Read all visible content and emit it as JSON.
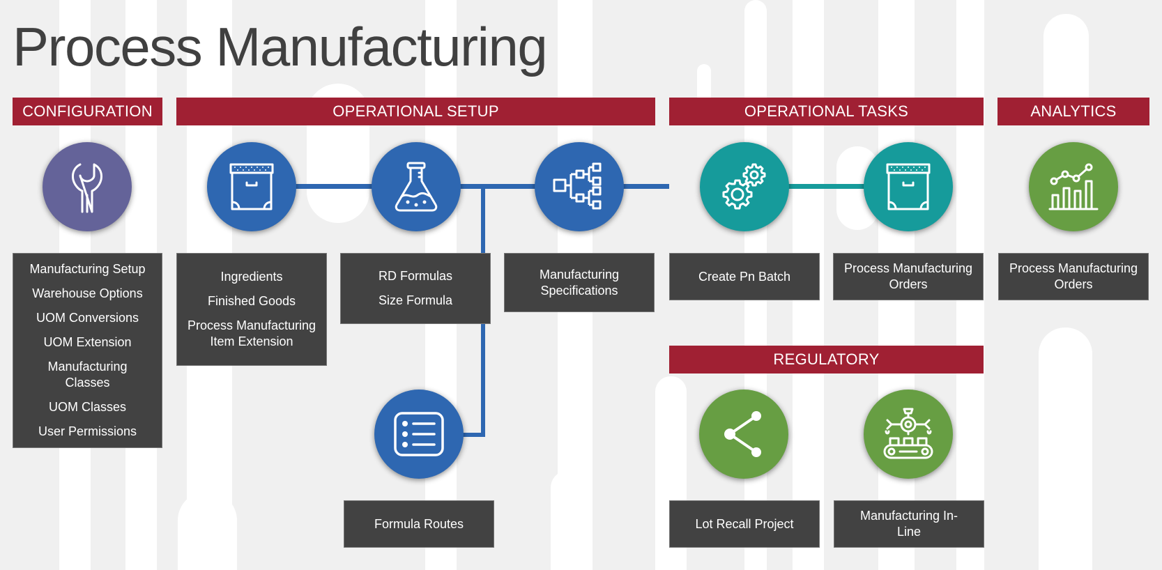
{
  "title": "Process Manufacturing",
  "colors": {
    "header": "#a02033",
    "configuration": "#646399",
    "operational_setup": "#2e67b1",
    "operational_tasks": "#169b9b",
    "analytics": "#679e43",
    "regulatory": "#679e43",
    "box": "#424242",
    "background": "#f0f0f0"
  },
  "sections": {
    "configuration": {
      "header": "CONFIGURATION",
      "icon": "wrench-icon",
      "items": [
        "Manufacturing Setup",
        "Warehouse Options",
        "UOM Conversions",
        "UOM Extension",
        "Manufacturing Classes",
        "UOM Classes",
        "User Permissions"
      ]
    },
    "operational_setup": {
      "header": "OPERATIONAL SETUP",
      "nodes": [
        {
          "icon": "storage-box-icon",
          "items": [
            "Ingredients",
            "Finished Goods",
            "Process Manufacturing Item Extension"
          ]
        },
        {
          "icon": "flask-icon",
          "items": [
            "RD Formulas",
            "Size Formula"
          ]
        },
        {
          "icon": "hierarchy-icon",
          "items": [
            "Manufacturing Specifications"
          ]
        },
        {
          "icon": "list-icon",
          "items": [
            "Formula Routes"
          ]
        }
      ]
    },
    "operational_tasks": {
      "header": "OPERATIONAL TASKS",
      "nodes": [
        {
          "icon": "gears-icon",
          "items": [
            "Create Pn Batch"
          ]
        },
        {
          "icon": "storage-box-icon",
          "items": [
            "Process Manufacturing Orders"
          ]
        }
      ]
    },
    "analytics": {
      "header": "ANALYTICS",
      "nodes": [
        {
          "icon": "chart-icon",
          "items": [
            "Process Manufacturing Orders"
          ]
        }
      ]
    },
    "regulatory": {
      "header": "REGULATORY",
      "nodes": [
        {
          "icon": "share-icon",
          "items": [
            "Lot Recall Project"
          ]
        },
        {
          "icon": "conveyor-robot-icon",
          "items": [
            "Manufacturing In-Line"
          ]
        }
      ]
    }
  }
}
